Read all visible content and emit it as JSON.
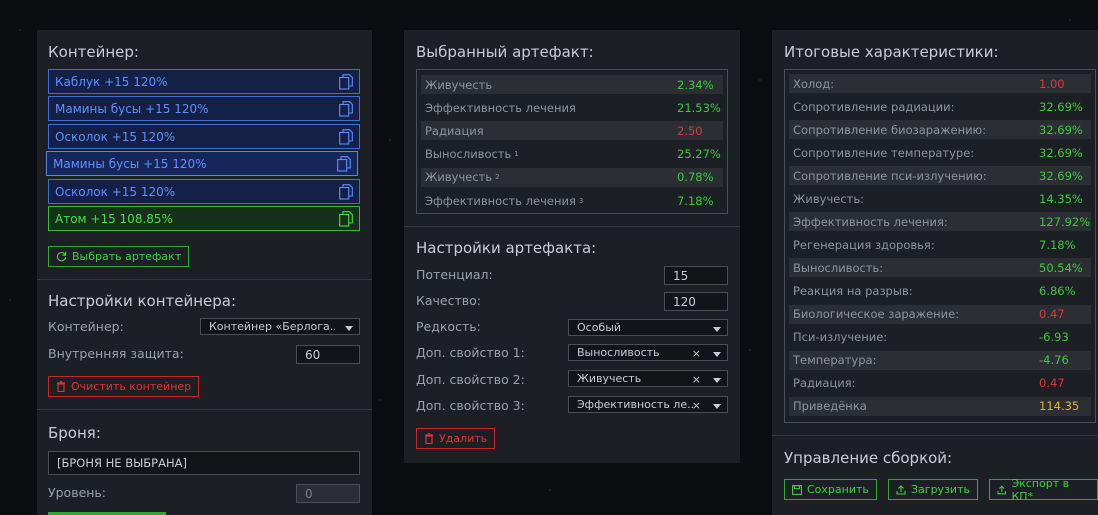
{
  "container": {
    "title": "Контейнер:",
    "slots": [
      {
        "label": "Каблук +15 120%",
        "kind": "blue"
      },
      {
        "label": "Мамины бусы +15 120%",
        "kind": "blue"
      },
      {
        "label": "Осколок +15 120%",
        "kind": "blue"
      },
      {
        "label": "Мамины бусы +15 120%",
        "kind": "blue-selected"
      },
      {
        "label": "Осколок +15 120%",
        "kind": "blue"
      },
      {
        "label": "Атом +15 108.85%",
        "kind": "green"
      }
    ],
    "choose_button": "Выбрать артефакт"
  },
  "container_settings": {
    "title": "Настройки контейнера:",
    "container_label": "Контейнер:",
    "container_value": "Контейнер «Берлога...",
    "protection_label": "Внутренняя защита:",
    "protection_value": "60",
    "clear_button": "Очистить контейнер"
  },
  "armor": {
    "title": "Броня:",
    "armor_value": "[БРОНЯ НЕ ВЫБРАНА]",
    "level_label": "Уровень:",
    "level_value": "0"
  },
  "selected": {
    "title": "Выбранный артефакт:",
    "rows": [
      {
        "label": "Живучесть",
        "sup": "",
        "value": "2.34%",
        "color": "g"
      },
      {
        "label": "Эффективность лечения",
        "sup": "",
        "value": "21.53%",
        "color": "g"
      },
      {
        "label": "Радиация",
        "sup": "",
        "value": "2.50",
        "color": "r"
      },
      {
        "label": "Выносливость",
        "sup": "1",
        "value": "25.27%",
        "color": "g"
      },
      {
        "label": "Живучесть",
        "sup": "2",
        "value": "0.78%",
        "color": "g"
      },
      {
        "label": "Эффективность лечения",
        "sup": "3",
        "value": "7.18%",
        "color": "g"
      }
    ]
  },
  "artifact_settings": {
    "title": "Настройки артефакта:",
    "potential_label": "Потенциал:",
    "potential_value": "15",
    "quality_label": "Качество:",
    "quality_value": "120",
    "rarity_label": "Редкость:",
    "rarity_value": "Особый",
    "prop1_label": "Доп. свойство 1:",
    "prop1_value": "Выносливость",
    "prop2_label": "Доп. свойство 2:",
    "prop2_value": "Живучесть",
    "prop3_label": "Доп. свойство 3:",
    "prop3_value": "Эффективность ле...",
    "clear_symbol": "×",
    "delete_button": "Удалить"
  },
  "totals": {
    "title": "Итоговые характеристики:",
    "rows": [
      {
        "label": "Холод:",
        "value": "1.00",
        "color": "r"
      },
      {
        "label": "Сопротивление радиации:",
        "value": "32.69%",
        "color": "g"
      },
      {
        "label": "Сопротивление биозаражению:",
        "value": "32.69%",
        "color": "g"
      },
      {
        "label": "Сопротивление температуре:",
        "value": "32.69%",
        "color": "g"
      },
      {
        "label": "Сопротивление пси-излучению:",
        "value": "32.69%",
        "color": "g"
      },
      {
        "label": "Живучесть:",
        "value": "14.35%",
        "color": "g"
      },
      {
        "label": "Эффективность лечения:",
        "value": "127.92%",
        "color": "g"
      },
      {
        "label": "Регенерация здоровья:",
        "value": "7.18%",
        "color": "g"
      },
      {
        "label": "Выносливость:",
        "value": "50.54%",
        "color": "g"
      },
      {
        "label": "Реакция на разрыв:",
        "value": "6.86%",
        "color": "g"
      },
      {
        "label": "Биологическое заражение:",
        "value": "0.47",
        "color": "r"
      },
      {
        "label": "Пси-излучение:",
        "value": "-6.93",
        "color": "g"
      },
      {
        "label": "Температура:",
        "value": "-4.76",
        "color": "g"
      },
      {
        "label": "Радиация:",
        "value": "0.47",
        "color": "r"
      },
      {
        "label": "Приведёнка",
        "value": "114.35",
        "color": "y"
      }
    ]
  },
  "build": {
    "title": "Управление сборкой:",
    "save_button": "Сохранить",
    "load_button": "Загрузить",
    "export_button": "Экспорт в КП*"
  }
}
